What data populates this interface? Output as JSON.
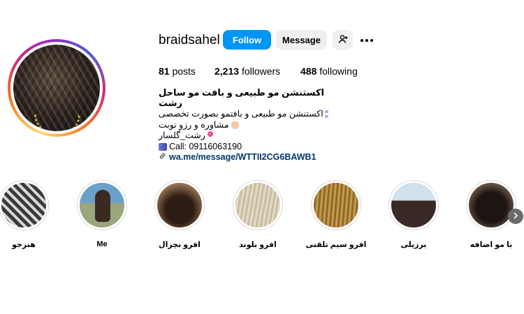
{
  "profile": {
    "username": "braidsahel",
    "follow_label": "Follow",
    "message_label": "Message",
    "stats": {
      "posts_count": "81",
      "posts_label": "posts",
      "followers_count": "2,213",
      "followers_label": "followers",
      "following_count": "488",
      "following_label": "following"
    },
    "bio": {
      "title": "اکستنشن مو طبیعی و بافت مو ساحل رشت",
      "line1": "اکستنشن مو طبیعی و بافتمو بصورت تخصصی",
      "line2": "مشاوره و رزو نوبت",
      "line3": "رشت_گلسار",
      "line4": "Call: 09116063190",
      "link": "wa.me/message/WTTII2CG6BAWB1"
    }
  },
  "highlights": [
    {
      "label": "هنرجو"
    },
    {
      "label": "Me"
    },
    {
      "label": "افرو نچرال"
    },
    {
      "label": "افرو بلوند"
    },
    {
      "label": "افرو سیم تلقنی"
    },
    {
      "label": "برزیلی"
    },
    {
      "label": "با مو اضافه"
    }
  ],
  "colors": {
    "primary_button": "#0095f6",
    "secondary_button": "#efefef",
    "link": "#00376b"
  },
  "icons": {
    "add_user": "person-plus-icon",
    "more": "more-horizontal-icon",
    "link": "link-icon",
    "next": "chevron-right-icon"
  }
}
